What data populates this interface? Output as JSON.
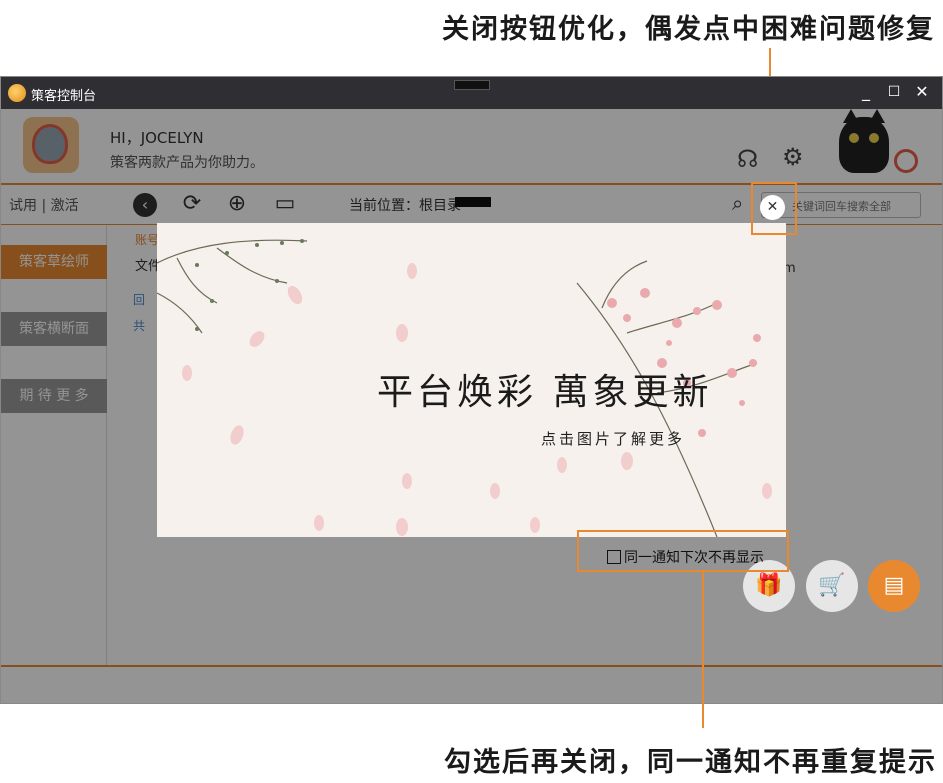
{
  "annotations": {
    "top": "关闭按钮优化，偶发点中困难问题修复",
    "bottom": "勾选后再关闭，同一通知不再重复提示"
  },
  "window": {
    "title": "策客控制台",
    "controls": {
      "minimize": "_",
      "maximize": "☐",
      "close": "✕"
    }
  },
  "header": {
    "greeting": "HI，JOCELYN",
    "subtitle": "策客两款产品为你助力。",
    "icons": [
      "support-icon",
      "settings-icon",
      "cat-mascot",
      "target-icon"
    ]
  },
  "toolbar": {
    "trial_activate": "试用 | 激活",
    "location_label": "当前位置：根目录",
    "search_placeholder": "关键词回车搜索全部",
    "icons": [
      "back-icon",
      "refresh-icon",
      "add-icon",
      "new-folder-icon",
      "search-icon"
    ]
  },
  "sidebar": {
    "items": [
      {
        "label": "策客草绘师",
        "active": true
      },
      {
        "label": "策客横断面",
        "active": false
      },
      {
        "label": "期 待 更 多",
        "active": false
      }
    ]
  },
  "content": {
    "account_label": "账号",
    "file_label": "文件",
    "rows": [
      "回",
      "共"
    ],
    "m_label": "m"
  },
  "footer": {
    "icons": [
      "gift-icon",
      "cart-icon",
      "document-icon"
    ]
  },
  "popup": {
    "title": "平台焕彩  萬象更新",
    "subtitle": "点击图片了解更多",
    "close_symbol": "✕",
    "dont_show_label": "同一通知下次不再显示",
    "dont_show_checked": false
  },
  "colors": {
    "accent": "#e8892f",
    "titlebar": "#2f2f33",
    "overlay": "#000000"
  }
}
